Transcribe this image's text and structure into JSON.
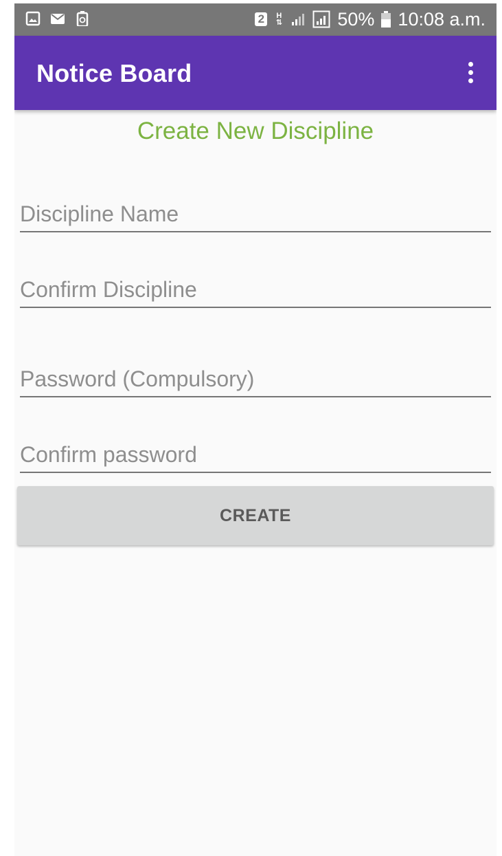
{
  "status_bar": {
    "left_icons": [
      "image-icon",
      "mail-icon",
      "battery-saver-icon"
    ],
    "sim_badge": "2",
    "network_type": "H",
    "battery_percent": "50%",
    "time": "10:08 a.m."
  },
  "app_bar": {
    "title": "Notice Board",
    "menu_icon": "overflow-menu-icon",
    "background_color": "#5e35b1"
  },
  "form": {
    "heading": "Create New Discipline",
    "heading_color": "#7cb342",
    "fields": [
      {
        "placeholder": "Discipline Name",
        "value": ""
      },
      {
        "placeholder": "Confirm Discipline",
        "value": ""
      },
      {
        "placeholder": "Password (Compulsory)",
        "value": ""
      },
      {
        "placeholder": "Confirm password",
        "value": ""
      }
    ],
    "submit_label": "CREATE"
  }
}
